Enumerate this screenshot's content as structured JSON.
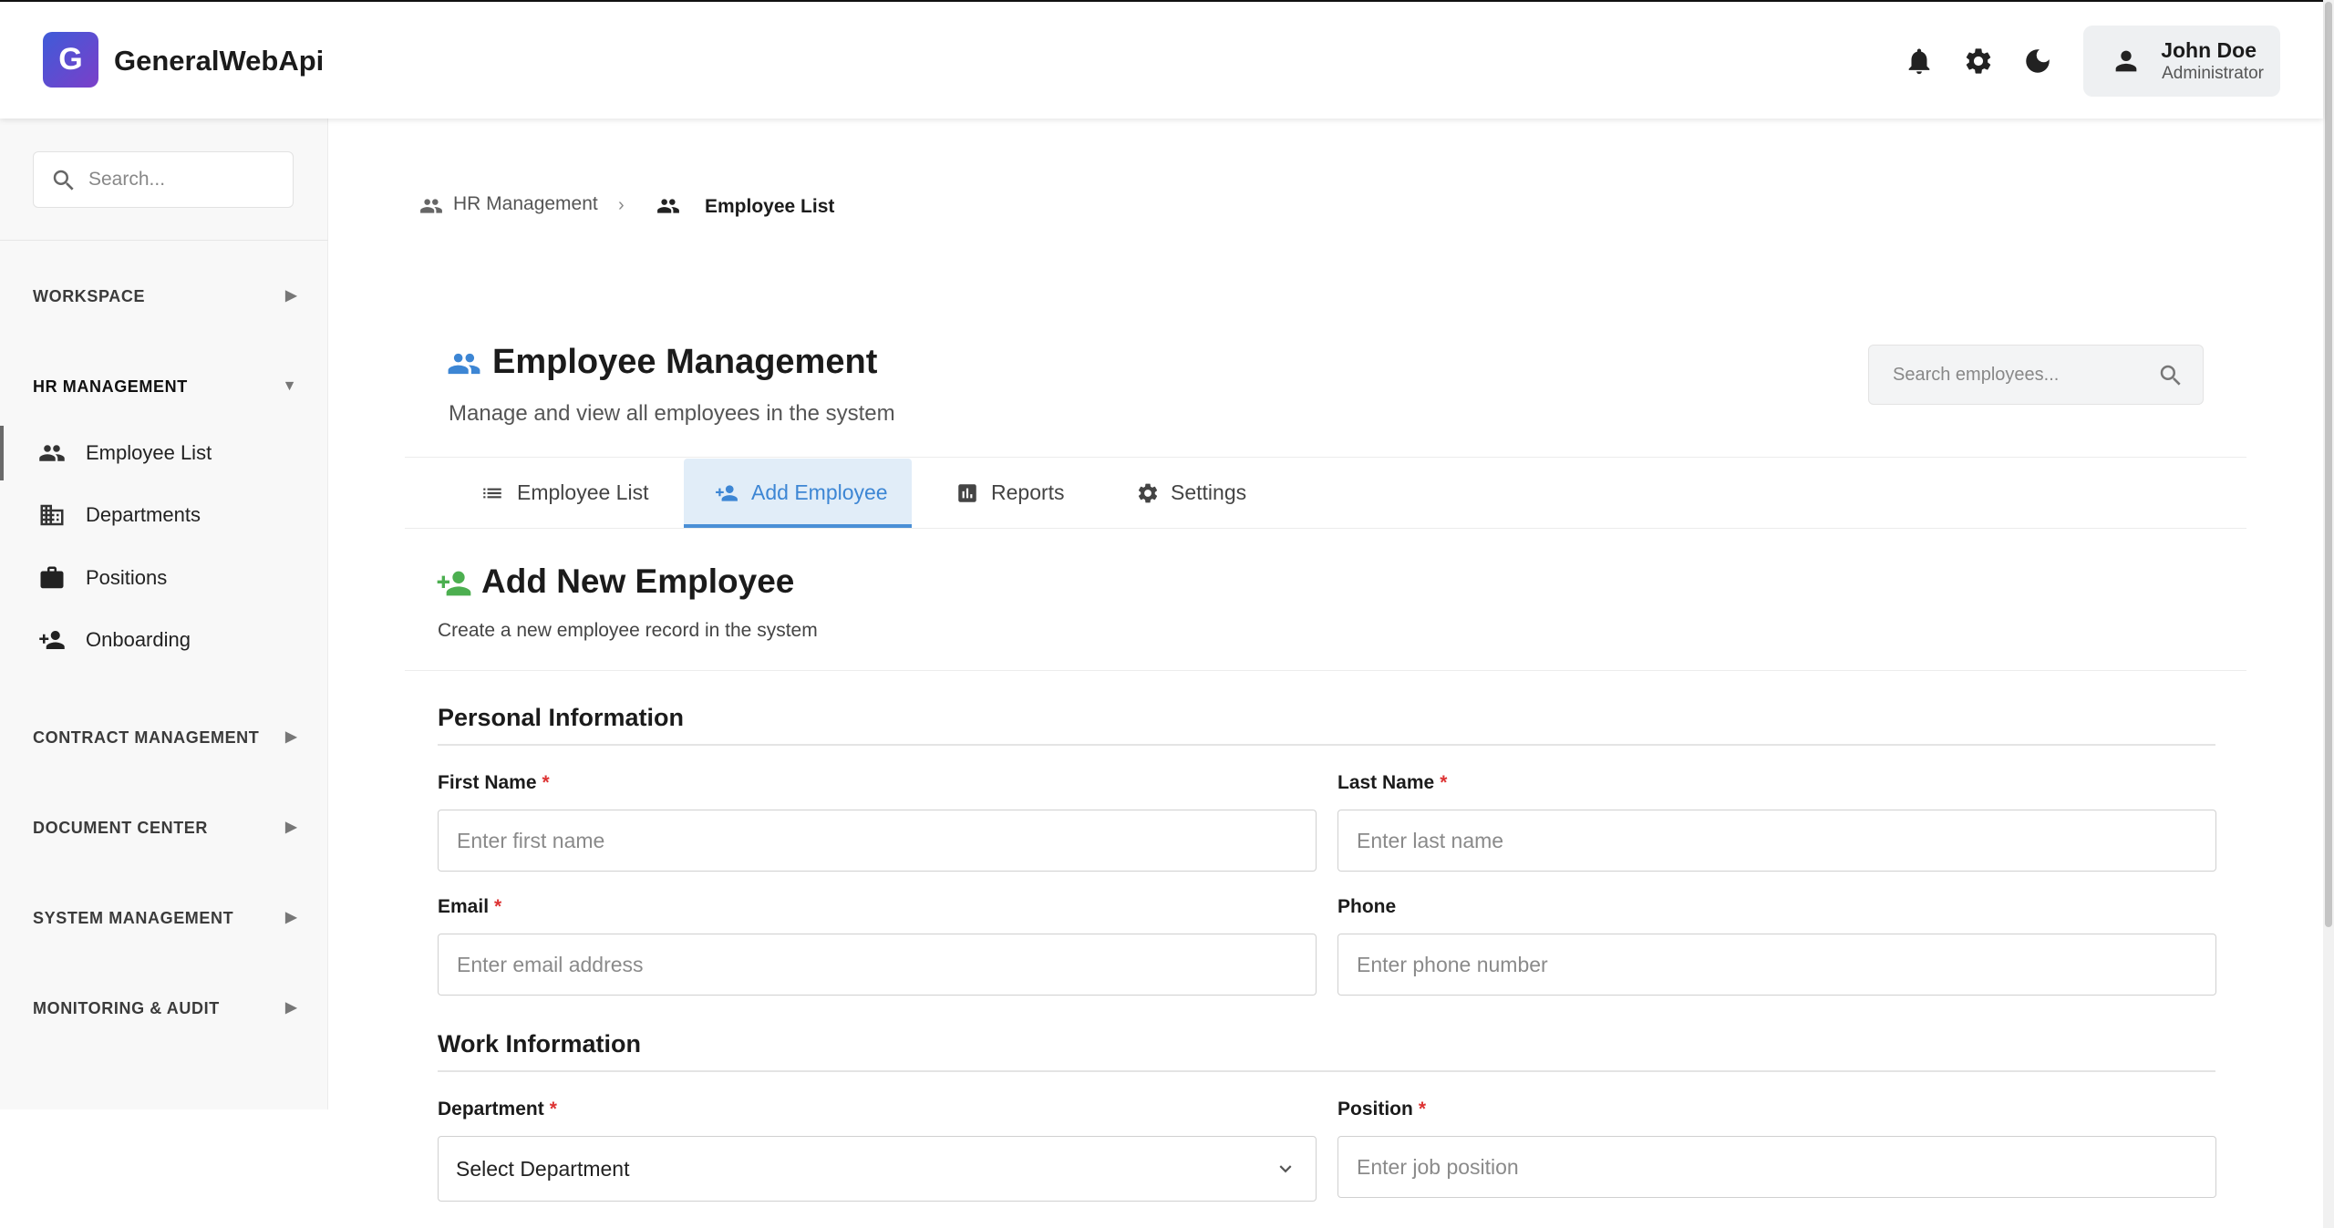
{
  "app": {
    "logo_letter": "G",
    "title": "GeneralWebApi"
  },
  "header": {
    "icons": [
      "bell-icon",
      "gear-icon",
      "moon-icon",
      "person-icon"
    ],
    "user": {
      "name": "John Doe",
      "role": "Administrator"
    }
  },
  "sidebar": {
    "search_placeholder": "Search...",
    "sections": [
      {
        "label": "WORKSPACE",
        "arrow": "▶"
      },
      {
        "label": "HR MANAGEMENT",
        "arrow": "▼"
      },
      {
        "label": "CONTRACT MANAGEMENT",
        "arrow": "▶"
      },
      {
        "label": "DOCUMENT CENTER",
        "arrow": "▶"
      },
      {
        "label": "SYSTEM MANAGEMENT",
        "arrow": "▶"
      },
      {
        "label": "MONITORING & AUDIT",
        "arrow": "▶"
      }
    ],
    "hr_items": [
      {
        "label": "Employee List",
        "icon": "people-icon",
        "active": true
      },
      {
        "label": "Departments",
        "icon": "building-icon",
        "active": false
      },
      {
        "label": "Positions",
        "icon": "briefcase-icon",
        "active": false
      },
      {
        "label": "Onboarding",
        "icon": "person-add-icon",
        "active": false
      }
    ]
  },
  "breadcrumb": {
    "parent": "HR Management",
    "separator": "›",
    "current": "Employee List"
  },
  "page": {
    "title": "Employee Management",
    "subtitle": "Manage and view all employees in the system",
    "search_placeholder": "Search employees..."
  },
  "tabs": [
    {
      "label": "Employee List",
      "icon": "list-icon",
      "active": false
    },
    {
      "label": "Add Employee",
      "icon": "person-add-icon",
      "active": true
    },
    {
      "label": "Reports",
      "icon": "bar-chart-icon",
      "active": false
    },
    {
      "label": "Settings",
      "icon": "gear-icon",
      "active": false
    }
  ],
  "form": {
    "title": "Add New Employee",
    "subtitle": "Create a new employee record in the system",
    "required_mark": "*",
    "personal_title": "Personal Information",
    "work_title": "Work Information",
    "first_name": {
      "label": "First Name",
      "placeholder": "Enter first name",
      "value": ""
    },
    "last_name": {
      "label": "Last Name",
      "placeholder": "Enter last name",
      "value": ""
    },
    "email": {
      "label": "Email",
      "placeholder": "Enter email address",
      "value": ""
    },
    "phone": {
      "label": "Phone",
      "placeholder": "Enter phone number",
      "value": ""
    },
    "department": {
      "label": "Department",
      "selected": "Select Department"
    },
    "position": {
      "label": "Position",
      "placeholder": "Enter job position",
      "value": ""
    }
  },
  "colors": {
    "accent": "#3d86d4",
    "tab_active_bg": "#e1edf8",
    "brand_gradient_start": "#3f5bd8",
    "brand_gradient_end": "#7b3fc9",
    "add_icon_green": "#4caf50",
    "required": "#d33333"
  }
}
